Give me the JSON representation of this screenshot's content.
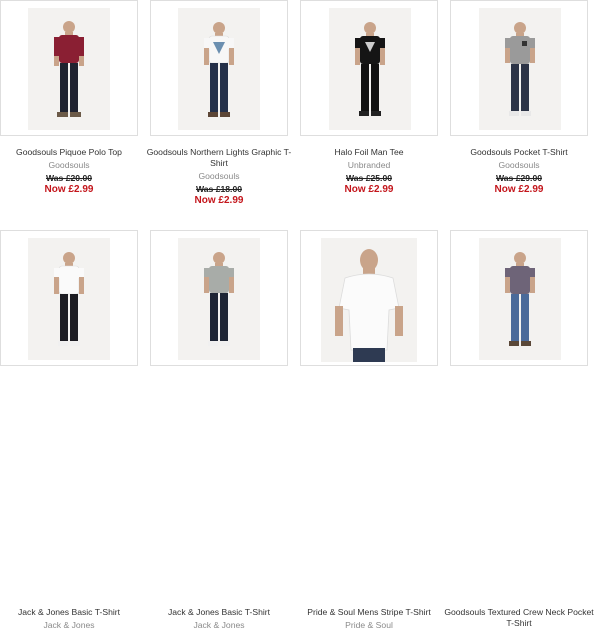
{
  "colors": {
    "sale": "#c4161c",
    "brand_text": "#8a8a8a",
    "border": "#dedede"
  },
  "products": [
    {
      "name": "Goodsouls Piquoe Polo Top",
      "brand": "Goodsouls",
      "was": "Was £20.00",
      "now": "Now £2.99",
      "image": "man-in-maroon-polo-image"
    },
    {
      "name": "Goodsouls Northern Lights Graphic T-Shirt",
      "brand": "Goodsouls",
      "was": "Was £18.00",
      "now": "Now £2.99",
      "image": "man-in-white-graphic-tee-image"
    },
    {
      "name": "Halo Foil Man Tee",
      "brand": "Unbranded",
      "was": "Was £25.00",
      "now": "Now £2.99",
      "image": "man-in-black-foil-tee-image"
    },
    {
      "name": "Goodsouls Pocket T-Shirt",
      "brand": "Goodsouls",
      "was": "Was £29.00",
      "now": "Now £2.99",
      "image": "man-in-grey-pocket-tee-image"
    },
    {
      "name": "Jack & Jones Basic T-Shirt",
      "brand": "Jack & Jones",
      "image": "man-in-white-basic-tee-image"
    },
    {
      "name": "Jack & Jones Basic T-Shirt",
      "brand": "Jack & Jones",
      "image": "man-in-grey-basic-tee-image"
    },
    {
      "name": "Pride & Soul Mens Stripe T-Shirt",
      "brand": "Pride & Soul",
      "image": "man-in-white-stripe-tee-image"
    },
    {
      "name": "Goodsouls Textured Crew Neck Pocket T-Shirt",
      "brand": "",
      "image": "man-in-purple-crew-tee-image"
    }
  ]
}
